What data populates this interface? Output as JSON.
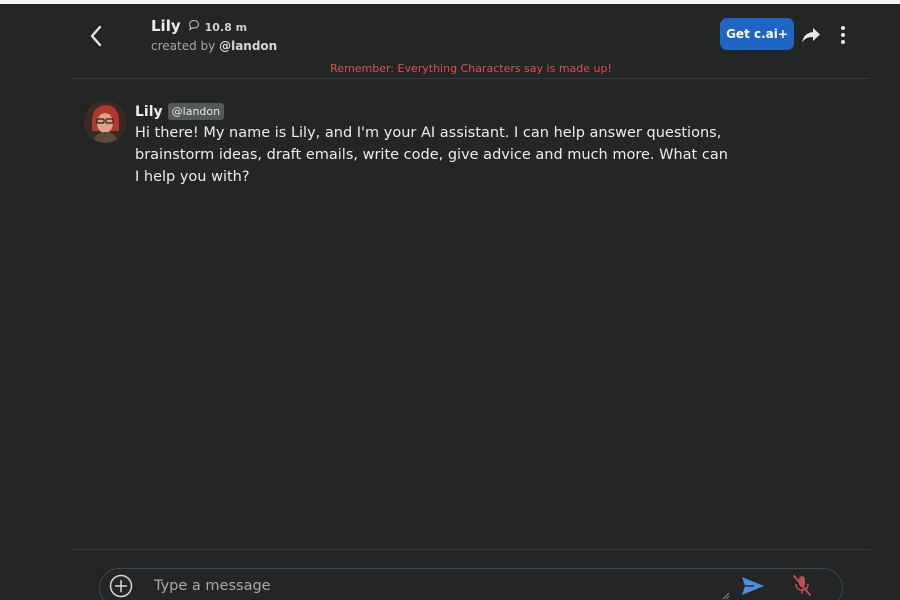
{
  "header": {
    "character_name": "Lily",
    "chat_count": "10.8 m",
    "created_by_prefix": "created by",
    "creator_handle": "@landon",
    "plus_button_label": "Get c.ai+",
    "disclaimer": "Remember: Everything Characters say is made up!"
  },
  "messages": [
    {
      "author": "Lily",
      "badge": "@landon",
      "text": "Hi there! My name is Lily, and I'm your AI assistant. I can help answer questions, brainstorm ideas, draft emails, write code, give advice and much more. What can I help you with?"
    }
  ],
  "composer": {
    "placeholder": "Type a message"
  },
  "colors": {
    "background": "#242525",
    "accent": "#1f66c4",
    "disclaimer": "#d9534f",
    "send_icon": "#4a90e2",
    "mic_icon": "#c0504d"
  },
  "icons": {
    "back": "chevron-left-icon",
    "chat": "chat-bubble-icon",
    "share": "share-arrow-icon",
    "more": "more-vertical-icon",
    "add": "add-circle-icon",
    "send": "send-icon",
    "mic": "mic-off-icon"
  }
}
